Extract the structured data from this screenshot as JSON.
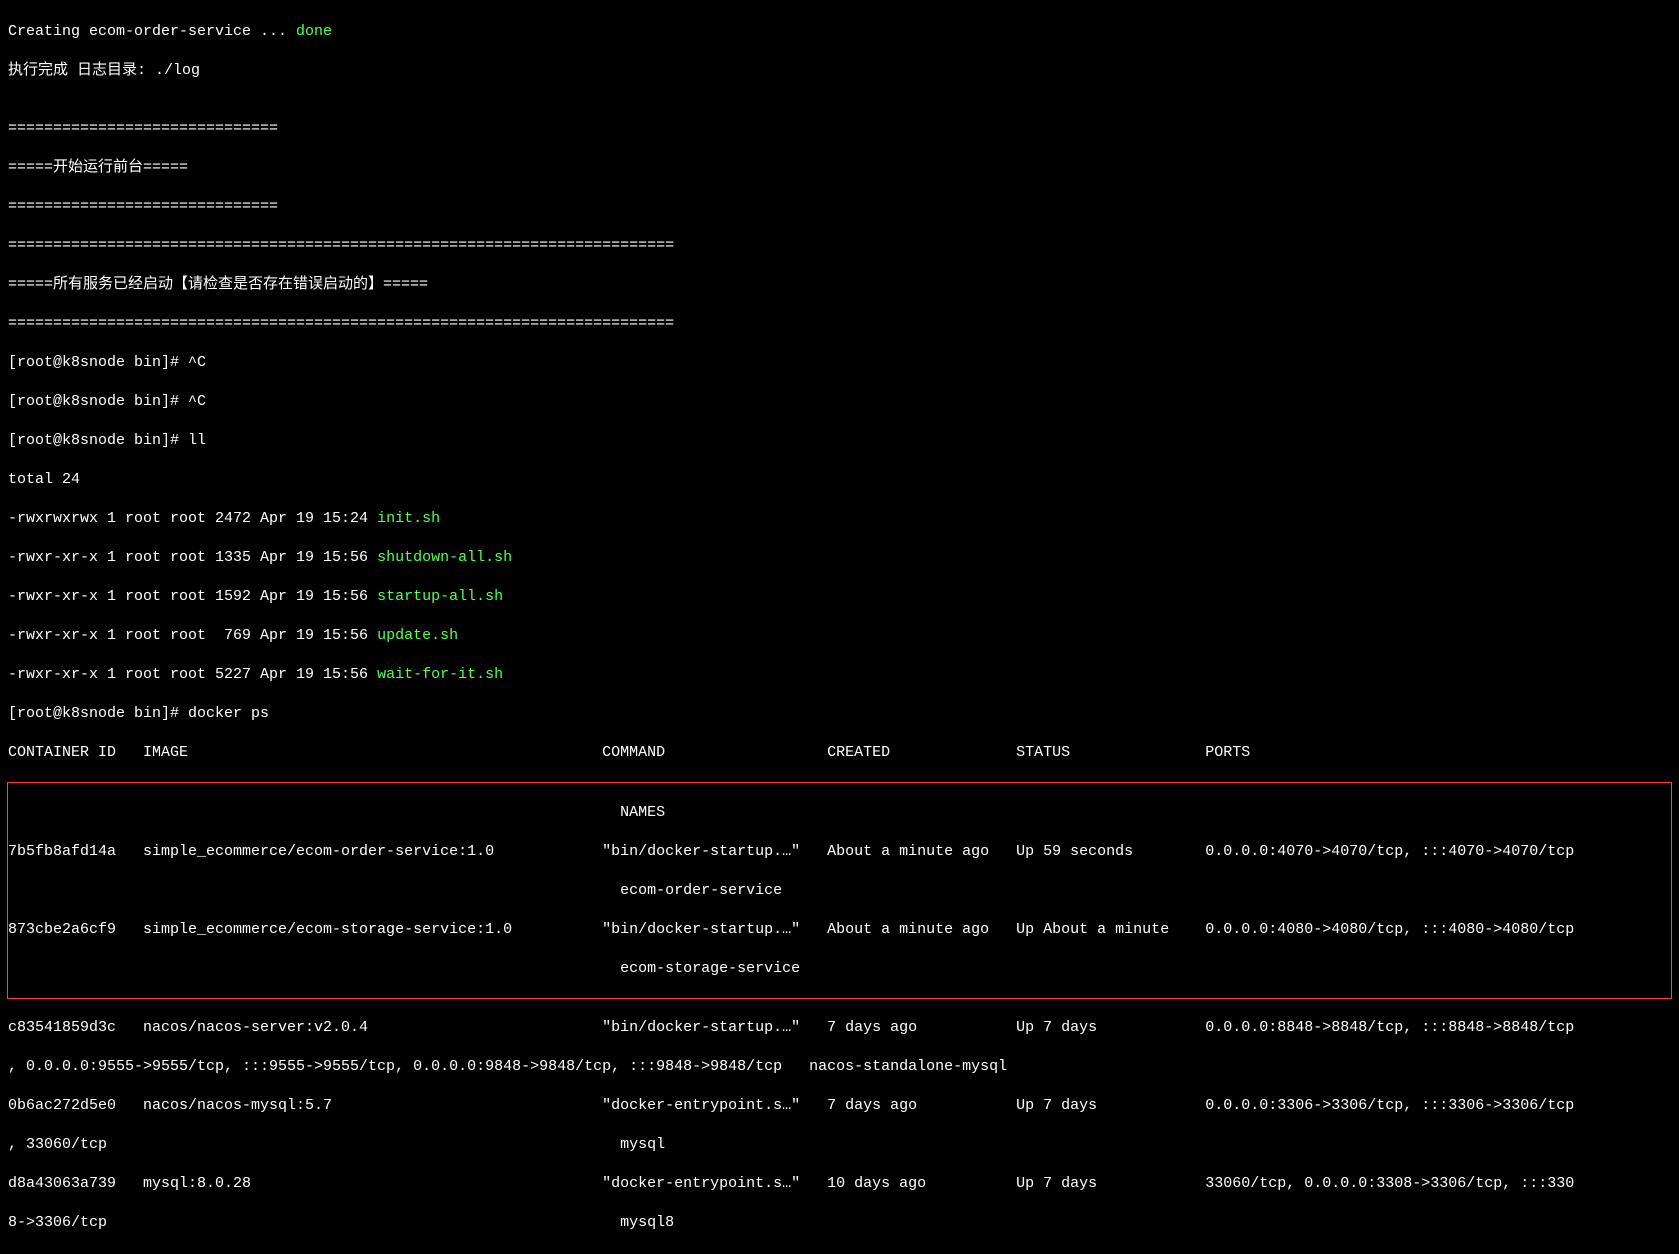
{
  "lines": {
    "creating_prefix": "Creating ecom-order-service ... ",
    "creating_done": "done",
    "exec_done": "执行完成 日志目录: ./log",
    "blank1": "",
    "sep1": "==============================",
    "banner1": "=====开始运行前台=====",
    "sep2": "==============================",
    "sep3a": "==========================================================================",
    "banner2": "=====所有服务已经启动【请检查是否存在错误启动的】=====",
    "sep3b": "==========================================================================",
    "prompt1": "[root@k8snode bin]# ^C",
    "prompt2": "[root@k8snode bin]# ^C",
    "prompt3": "[root@k8snode bin]# ll",
    "total": "total 24",
    "ls1_meta": "-rwxrwxrwx 1 root root 2472 Apr 19 15:24 ",
    "ls1_file": "init.sh",
    "ls2_meta": "-rwxr-xr-x 1 root root 1335 Apr 19 15:56 ",
    "ls2_file": "shutdown-all.sh",
    "ls3_meta": "-rwxr-xr-x 1 root root 1592 Apr 19 15:56 ",
    "ls3_file": "startup-all.sh",
    "ls4_meta": "-rwxr-xr-x 1 root root  769 Apr 19 15:56 ",
    "ls4_file": "update.sh",
    "ls5_meta": "-rwxr-xr-x 1 root root 5227 Apr 19 15:56 ",
    "ls5_file": "wait-for-it.sh",
    "prompt4": "[root@k8snode bin]# docker ps",
    "ps_header1": "CONTAINER ID   IMAGE                                              COMMAND                  CREATED              STATUS               PORTS",
    "ps_header2": "                                                                    NAMES",
    "row1a": "7b5fb8afd14a   simple_ecommerce/ecom-order-service:1.0            \"bin/docker-startup.…\"   About a minute ago   Up 59 seconds        0.0.0.0:4070->4070/tcp, :::4070->4070/tcp",
    "row1b": "                                                                    ecom-order-service",
    "row2a": "873cbe2a6cf9   simple_ecommerce/ecom-storage-service:1.0          \"bin/docker-startup.…\"   About a minute ago   Up About a minute    0.0.0.0:4080->4080/tcp, :::4080->4080/tcp",
    "row2b": "                                                                    ecom-storage-service",
    "row3a": "c83541859d3c   nacos/nacos-server:v2.0.4                          \"bin/docker-startup.…\"   7 days ago           Up 7 days            0.0.0.0:8848->8848/tcp, :::8848->8848/tcp",
    "row3b": ", 0.0.0.0:9555->9555/tcp, :::9555->9555/tcp, 0.0.0.0:9848->9848/tcp, :::9848->9848/tcp   nacos-standalone-mysql",
    "row4a": "0b6ac272d5e0   nacos/nacos-mysql:5.7                              \"docker-entrypoint.s…\"   7 days ago           Up 7 days            0.0.0.0:3306->3306/tcp, :::3306->3306/tcp",
    "row4b": ", 33060/tcp                                                         mysql",
    "row5a": "d8a43063a739   mysql:8.0.28                                       \"docker-entrypoint.s…\"   10 days ago          Up 7 days            33060/tcp, 0.0.0.0:3308->3306/tcp, :::330",
    "row5b": "8->3306/tcp                                                         mysql8"
  }
}
